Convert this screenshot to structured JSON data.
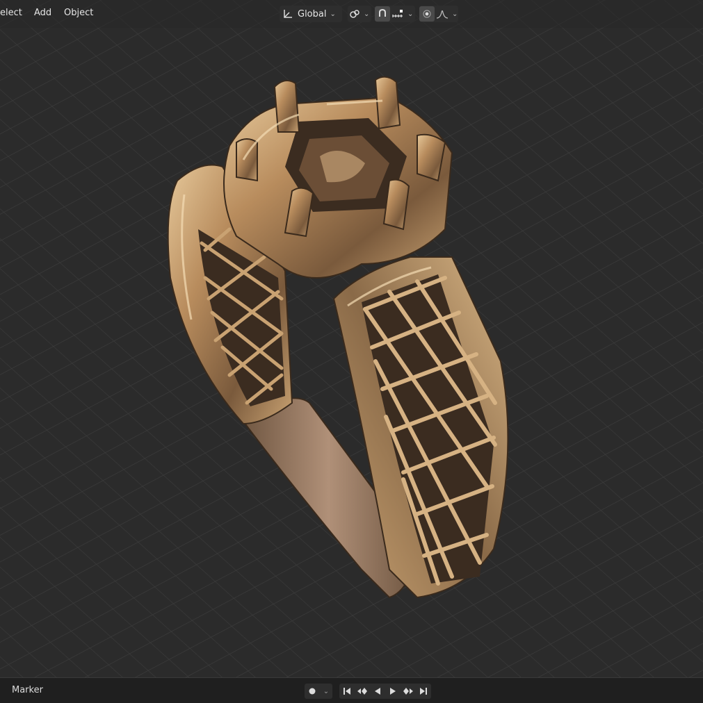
{
  "header": {
    "menu": [
      "elect",
      "Add",
      "Object"
    ],
    "transform_orientation": "Global"
  },
  "icons": {
    "orientation": "axes-icon",
    "pivot": "pivot-point-icon",
    "snap": "snap-magnet-icon",
    "snap_target": "snap-target-icon",
    "proportional": "proportional-edit-icon",
    "falloff": "falloff-curve-icon"
  },
  "timeline": {
    "marker_label": "Marker",
    "controls": [
      "jump-to-start-icon",
      "prev-keyframe-icon",
      "play-reverse-icon",
      "play-icon",
      "next-keyframe-icon",
      "jump-to-end-icon"
    ]
  },
  "colors": {
    "viewport_bg": "#2b2b2b",
    "grid_line": "#3a3a3a",
    "metal": "#b58a5c",
    "metal_highlight": "#e6c89a",
    "metal_shadow": "#4a3522"
  }
}
